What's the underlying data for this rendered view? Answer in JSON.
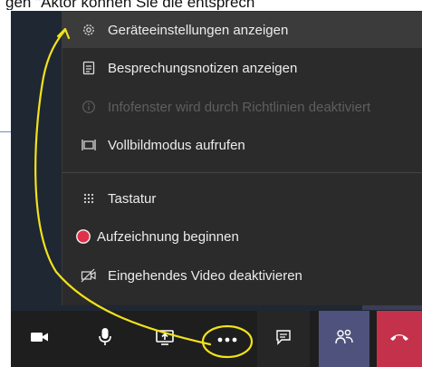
{
  "header": {
    "partial_text": "gen \"Aktor können Sie die entsprech"
  },
  "menu": {
    "items": [
      {
        "icon": "gear-icon",
        "label": "Geräteeinstellungen anzeigen",
        "state": "hover"
      },
      {
        "icon": "notes-icon",
        "label": "Besprechungsnotizen anzeigen",
        "state": "normal"
      },
      {
        "icon": "info-icon",
        "label": "Infofenster wird durch Richtlinien deaktiviert",
        "state": "disabled"
      },
      {
        "icon": "fullscreen-icon",
        "label": "Vollbildmodus aufrufen",
        "state": "normal"
      },
      {
        "icon": "keypad-icon",
        "label": "Tastatur",
        "state": "normal"
      },
      {
        "icon": "record-icon",
        "label": "Aufzeichnung beginnen",
        "state": "normal"
      },
      {
        "icon": "video-off-icon",
        "label": "Eingehendes Video deaktivieren",
        "state": "normal"
      }
    ]
  },
  "toolbar": {
    "buttons": [
      {
        "icon": "camera-icon"
      },
      {
        "icon": "microphone-icon"
      },
      {
        "icon": "share-screen-icon"
      },
      {
        "icon": "more-options-icon"
      },
      {
        "icon": "chat-icon"
      },
      {
        "icon": "participants-icon"
      },
      {
        "icon": "hang-up-icon"
      }
    ]
  },
  "colors": {
    "menu_bg": "#2b2b2b",
    "menu_hover": "#3b3b3b",
    "text": "#ececec",
    "disabled_text": "#5e5e5e",
    "record_red": "#e0314b",
    "hangup_red": "#c4314b",
    "people_purple": "#4f527c",
    "annotation_yellow": "#f2e21a"
  }
}
